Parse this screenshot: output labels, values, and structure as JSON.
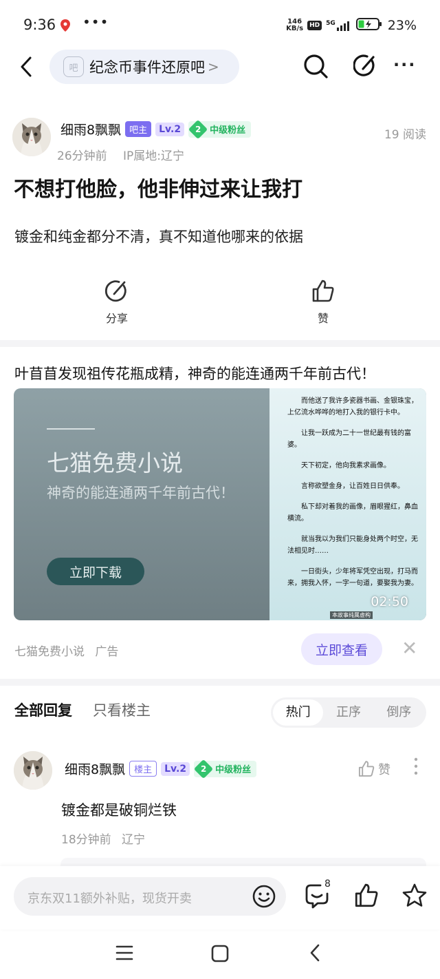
{
  "status_bar": {
    "time": "9:36",
    "more": "•••",
    "net_speed_value": "146",
    "net_speed_unit": "KB/s",
    "hd": "HD",
    "network": "5G",
    "battery": "23%"
  },
  "nav": {
    "forum_icon_text": "吧",
    "forum_name": "纪念币事件还原吧",
    "forum_chevron": ">",
    "more": "···"
  },
  "post": {
    "author": "细雨8飘飘",
    "role_badge": "吧主",
    "level": "Lv.2",
    "fan_level": "2",
    "fan_title": "中级粉丝",
    "read_count": "19 阅读",
    "time": "26分钟前",
    "ip": "IP属地:辽宁",
    "title": "不想打他脸，他非伸过来让我打",
    "body": "镀金和纯金都分不清，真不知道他哪来的依据",
    "share_label": "分享",
    "like_label": "赞"
  },
  "ad": {
    "title": "叶苜苜发现祖传花瓶成精，神奇的能连通两千年前古代！",
    "brand": "七猫免费小说",
    "slogan": "神奇的能连通两千年前古代！",
    "download_label": "立即下载",
    "story": [
      "而他送了我许多瓷器书画、金银珠宝，上亿流水哗哗的地打入我的银行卡中。",
      "让我一跃成为二十一世纪最有钱的富婆。",
      "天下初定，他向我素求画像。",
      "言称欲塑金身，让百姓日日供奉。",
      "私下却对着我的画像，眉眼猩红，鼻血横流。",
      "就当我以为我们只能身处两个时空，无法相见时……",
      "一日街头，少年将军凭空出现，打马而来，拥我入怀，一字一句道，要娶我为妻。"
    ],
    "caption": "本故事纯属虚构",
    "duration": "02:50",
    "source": "七猫免费小说",
    "ad_label": "广告",
    "view_label": "立即查看",
    "close": "✕"
  },
  "replies": {
    "tab_all": "全部回复",
    "tab_owner": "只看楼主",
    "sort": [
      "热门",
      "正序",
      "倒序"
    ],
    "active_sort": 0
  },
  "comment": {
    "author": "细雨8飘飘",
    "role_badge": "楼主",
    "level": "Lv.2",
    "fan_level": "2",
    "fan_title": "中级粉丝",
    "like_label": "赞",
    "text": "镀金都是破铜烂铁",
    "time": "18分钟前",
    "location": "辽宁"
  },
  "bottom": {
    "placeholder": "京东双11额外补贴，现货开卖",
    "comment_count": "8"
  },
  "colors": {
    "accent": "#7c6ef0",
    "fan_green": "#33c46d",
    "view_btn_bg": "#edeaff"
  }
}
